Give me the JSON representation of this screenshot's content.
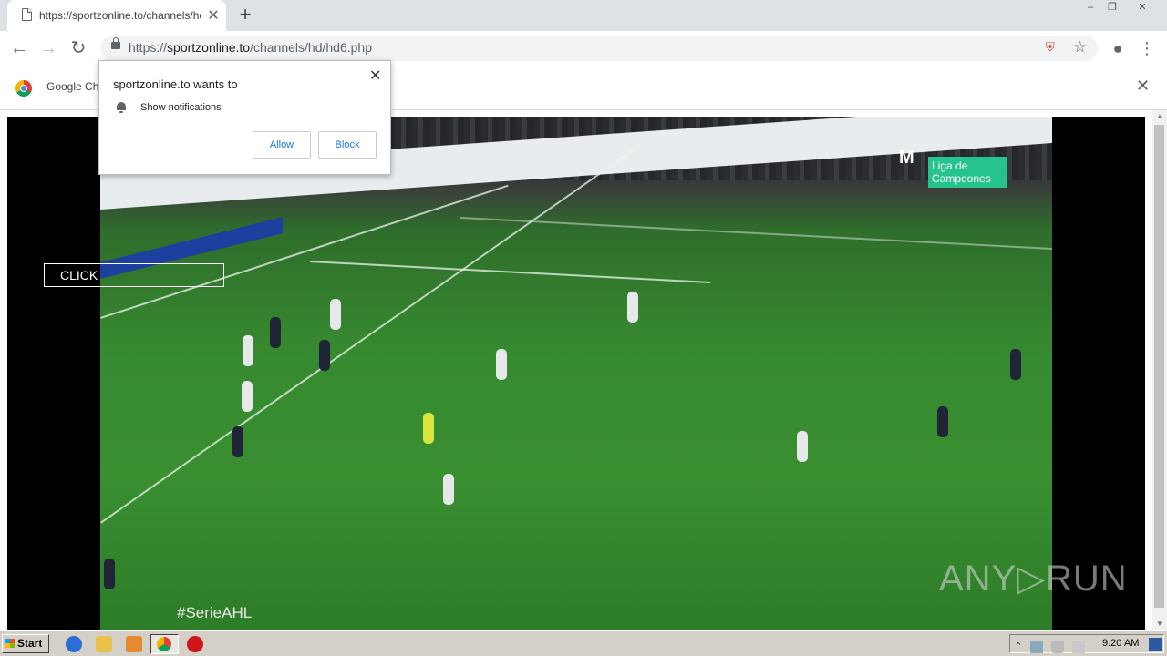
{
  "browser": {
    "tab_title": "https://sportzonline.to/channels/hd/",
    "tab_close": "✕",
    "new_tab": "+",
    "url_scheme": "https://",
    "url_host": "sportzonline.to",
    "url_path": "/channels/hd/hd6.php",
    "window_controls": {
      "minimize": "–",
      "maximize": "❐",
      "close": "✕"
    }
  },
  "toolbar": {
    "back": "←",
    "forward": "→",
    "reload": "↻",
    "star": "☆",
    "account": "●",
    "menu": "⋮",
    "ext_icon": "⛨"
  },
  "infobar": {
    "text": "Google Ch",
    "close": "✕"
  },
  "notification": {
    "title": "sportzonline.to wants to",
    "permission": "Show notifications",
    "allow_label": "Allow",
    "block_label": "Block",
    "close": "✕"
  },
  "video": {
    "click_label": "CLICK",
    "hashtag": "#SerieAHL",
    "broadcaster": "M",
    "competition": "Liga de Campeones",
    "watermark": "ANY▷RUN"
  },
  "taskbar": {
    "start_label": "Start",
    "clock": "9:20 AM",
    "tray_arrow": "⌃"
  }
}
